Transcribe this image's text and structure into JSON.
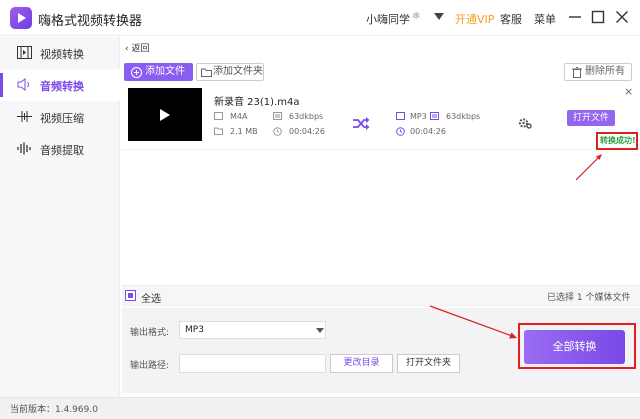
{
  "app": {
    "title": "嗨格式视频转换器"
  },
  "header": {
    "user_name": "小嗨同学",
    "user_badge": "❄",
    "vip": "开通VIP",
    "service": "客服",
    "menu": "菜单"
  },
  "sidebar": {
    "items": [
      {
        "label": "视频转换",
        "icon": "video-convert-icon"
      },
      {
        "label": "音频转换",
        "icon": "audio-convert-icon",
        "active": true
      },
      {
        "label": "视频压缩",
        "icon": "compress-icon"
      },
      {
        "label": "音频提取",
        "icon": "waveform-icon"
      }
    ]
  },
  "toolbar": {
    "back": "返回",
    "add_file": "添加文件",
    "add_folder": "添加文件夹",
    "delete_all": "删除所有"
  },
  "file": {
    "name": "新录音 23(1).m4a",
    "source": {
      "format": "M4A",
      "bitrate": "63dkbps",
      "size": "2.1 MB",
      "duration": "00:04:26"
    },
    "target": {
      "format": "MP3",
      "bitrate": "63dkbps",
      "duration": "00:04:26"
    },
    "open_file": "打开文件",
    "status": "转换成功!"
  },
  "footer": {
    "select_all": "全选",
    "selected_count": "已选择 1 个媒体文件",
    "format_label": "输出格式:",
    "format_value": "MP3",
    "path_label": "输出路径:",
    "path_value": "",
    "change_dir": "更改目录",
    "open_folder": "打开文件夹",
    "convert_all": "全部转换"
  },
  "version": "当前版本：1.4.969.0",
  "colors": {
    "accent": "#7a4be8",
    "success": "#2aa040",
    "highlight": "#e02020",
    "vip": "#f0a020"
  }
}
